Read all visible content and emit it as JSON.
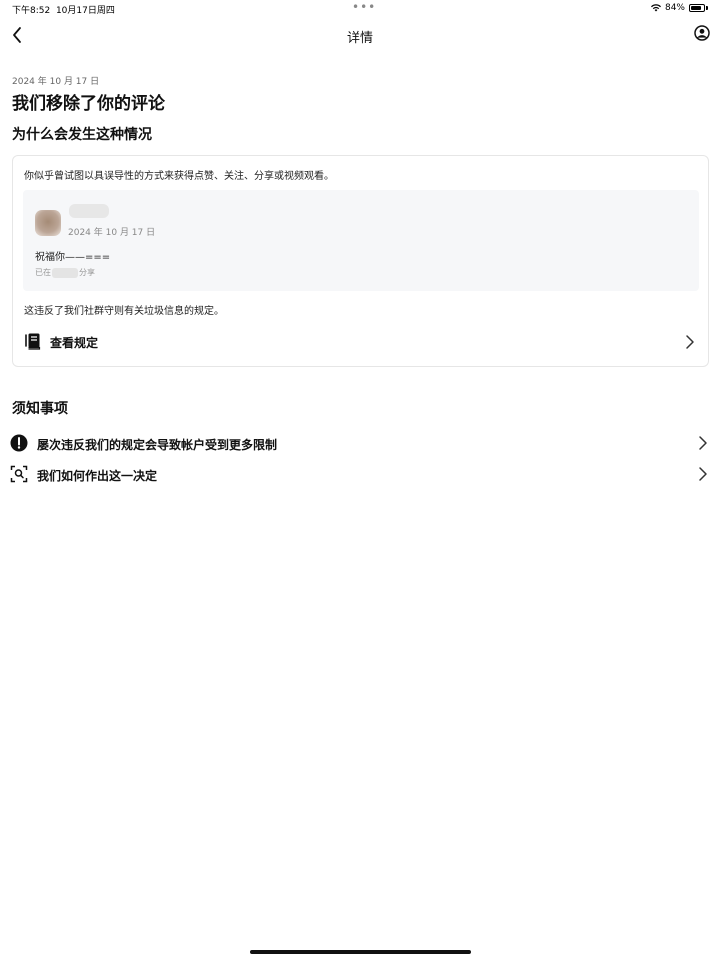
{
  "status_bar": {
    "time": "下午8:52",
    "date": "10月17日周四",
    "battery": "84%",
    "battery_level": 0.84,
    "dots": "•••"
  },
  "nav": {
    "title": "详情",
    "back_icon": "chevron-left-icon",
    "profile_icon": "profile-circle-icon"
  },
  "header": {
    "date": "2024 年 10 月 17 日",
    "title": "我们移除了你的评论",
    "why_title": "为什么会发生这种情况"
  },
  "card": {
    "description": "你似乎曾试图以具误导性的方式来获得点赞、关注、分享或视频观看。",
    "comment": {
      "date": "2024 年 10 月 17 日",
      "text": "祝福你——===",
      "shared_prefix": "已在",
      "shared_suffix": "分享"
    },
    "violation": "这违反了我们社群守则有关垃圾信息的规定。",
    "rules_link": "查看规定",
    "rules_icon": "book-icon"
  },
  "notes": {
    "title": "须知事项",
    "items": [
      {
        "label": "屡次违反我们的规定会导致帐户受到更多限制",
        "icon": "exclamation-circle-icon"
      },
      {
        "label": "我们如何作出这一决定",
        "icon": "scan-person-icon"
      }
    ]
  }
}
